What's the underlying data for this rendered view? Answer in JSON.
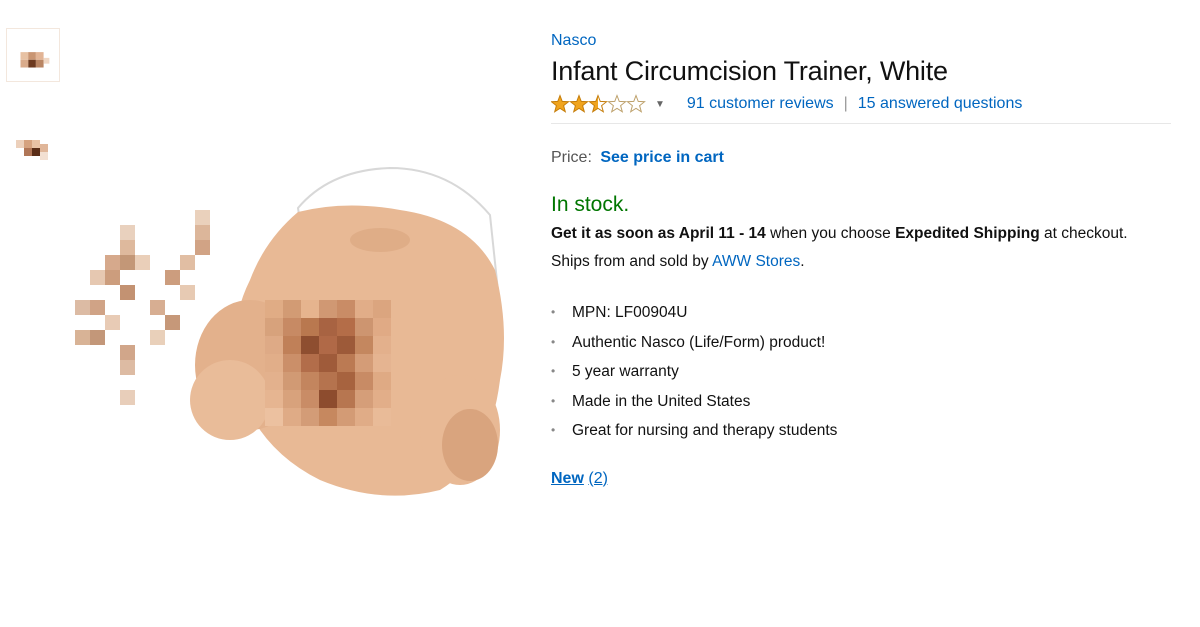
{
  "product": {
    "brand": "Nasco",
    "title": "Infant Circumcision Trainer, White",
    "rating": 2.5,
    "rating_max": 5,
    "reviews_link": "91 customer reviews",
    "separator": "|",
    "questions_link": "15 answered questions"
  },
  "price": {
    "label": "Price:",
    "value": "See price in cart"
  },
  "availability": {
    "status": "In stock.",
    "delivery_prefix": "Get it as soon as April 11 - 14",
    "delivery_mid": " when you choose ",
    "delivery_method": "Expedited Shipping",
    "delivery_suffix": " at checkout.",
    "ships_prefix": "Ships from and sold by ",
    "seller": "AWW Stores",
    "ships_suffix": "."
  },
  "features": [
    "MPN: LF00904U",
    "Authentic Nasco (Life/Form) product!",
    "5 year warranty",
    "Made in the United States",
    "Great for nursing and therapy students"
  ],
  "offers": {
    "label": "New",
    "count": "(2)"
  },
  "colors": {
    "link": "#0066c0",
    "in_stock": "#007600",
    "star": "#f0a41e"
  },
  "icons": {
    "bullet": "•",
    "caret": "▼"
  }
}
